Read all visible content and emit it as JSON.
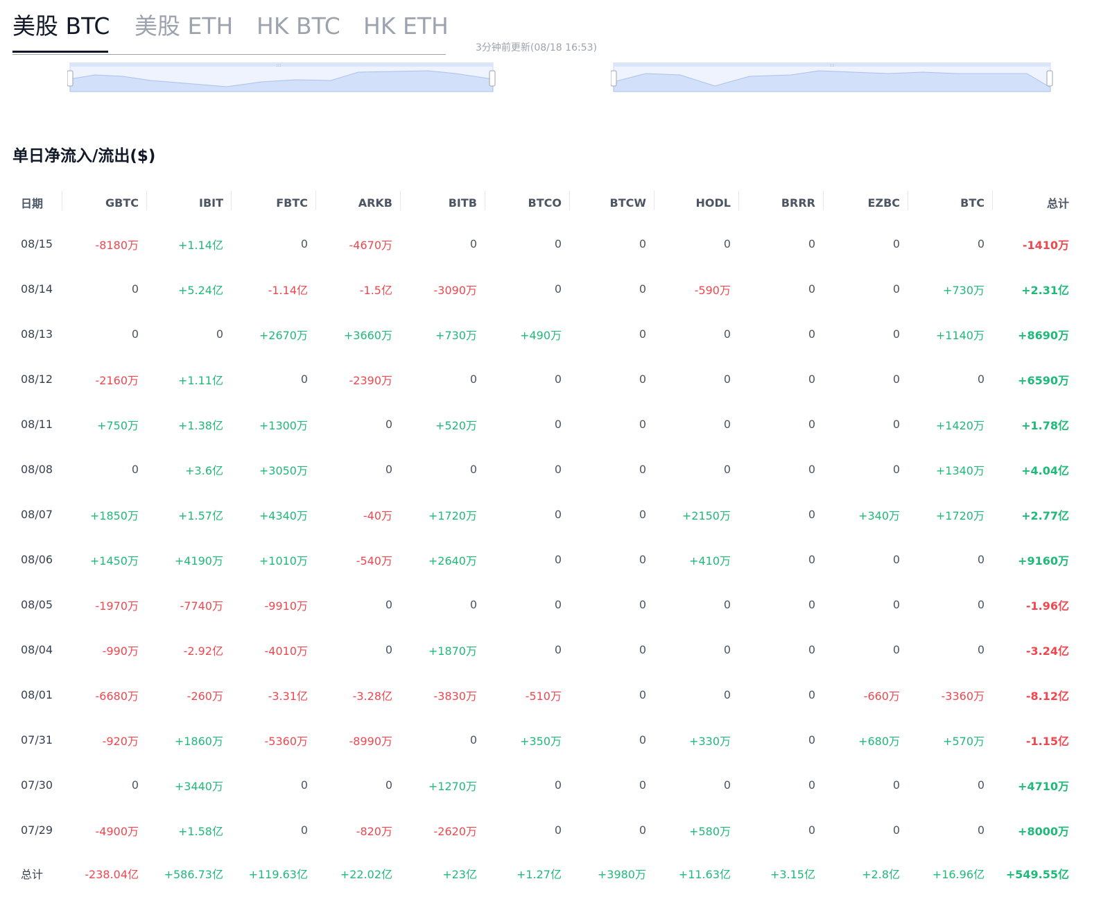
{
  "tabs": [
    {
      "label": "美股 BTC",
      "active": true
    },
    {
      "label": "美股 ETH",
      "active": false
    },
    {
      "label": "HK BTC",
      "active": false
    },
    {
      "label": "HK ETH",
      "active": false
    }
  ],
  "update_note": "3分钟前更新(08/18 16:53)",
  "section_title": "单日净流入/流出($)",
  "colors": {
    "positive": "#1fb978",
    "negative": "#f0474f",
    "slider_fill": "#d6e4fb",
    "slider_line": "#a8c1f0"
  },
  "table": {
    "headers": [
      "日期",
      "GBTC",
      "IBIT",
      "FBTC",
      "ARKB",
      "BITB",
      "BTCO",
      "BTCW",
      "HODL",
      "BRRR",
      "EZBC",
      "BTC",
      "总计"
    ],
    "rows": [
      [
        "08/15",
        "-8180万",
        "+1.14亿",
        "0",
        "-4670万",
        "0",
        "0",
        "0",
        "0",
        "0",
        "0",
        "0",
        "-1410万"
      ],
      [
        "08/14",
        "0",
        "+5.24亿",
        "-1.14亿",
        "-1.5亿",
        "-3090万",
        "0",
        "0",
        "-590万",
        "0",
        "0",
        "+730万",
        "+2.31亿"
      ],
      [
        "08/13",
        "0",
        "0",
        "+2670万",
        "+3660万",
        "+730万",
        "+490万",
        "0",
        "0",
        "0",
        "0",
        "+1140万",
        "+8690万"
      ],
      [
        "08/12",
        "-2160万",
        "+1.11亿",
        "0",
        "-2390万",
        "0",
        "0",
        "0",
        "0",
        "0",
        "0",
        "0",
        "+6590万"
      ],
      [
        "08/11",
        "+750万",
        "+1.38亿",
        "+1300万",
        "0",
        "+520万",
        "0",
        "0",
        "0",
        "0",
        "0",
        "+1420万",
        "+1.78亿"
      ],
      [
        "08/08",
        "0",
        "+3.6亿",
        "+3050万",
        "0",
        "0",
        "0",
        "0",
        "0",
        "0",
        "0",
        "+1340万",
        "+4.04亿"
      ],
      [
        "08/07",
        "+1850万",
        "+1.57亿",
        "+4340万",
        "-40万",
        "+1720万",
        "0",
        "0",
        "+2150万",
        "0",
        "+340万",
        "+1720万",
        "+2.77亿"
      ],
      [
        "08/06",
        "+1450万",
        "+4190万",
        "+1010万",
        "-540万",
        "+2640万",
        "0",
        "0",
        "+410万",
        "0",
        "0",
        "0",
        "+9160万"
      ],
      [
        "08/05",
        "-1970万",
        "-7740万",
        "-9910万",
        "0",
        "0",
        "0",
        "0",
        "0",
        "0",
        "0",
        "0",
        "-1.96亿"
      ],
      [
        "08/04",
        "-990万",
        "-2.92亿",
        "-4010万",
        "0",
        "+1870万",
        "0",
        "0",
        "0",
        "0",
        "0",
        "0",
        "-3.24亿"
      ],
      [
        "08/01",
        "-6680万",
        "-260万",
        "-3.31亿",
        "-3.28亿",
        "-3830万",
        "-510万",
        "0",
        "0",
        "0",
        "-660万",
        "-3360万",
        "-8.12亿"
      ],
      [
        "07/31",
        "-920万",
        "+1860万",
        "-5360万",
        "-8990万",
        "0",
        "+350万",
        "0",
        "+330万",
        "0",
        "+680万",
        "+570万",
        "-1.15亿"
      ],
      [
        "07/30",
        "0",
        "+3440万",
        "0",
        "0",
        "+1270万",
        "0",
        "0",
        "0",
        "0",
        "0",
        "0",
        "+4710万"
      ],
      [
        "07/29",
        "-4900万",
        "+1.58亿",
        "0",
        "-820万",
        "-2620万",
        "0",
        "0",
        "+580万",
        "0",
        "0",
        "0",
        "+8000万"
      ]
    ],
    "total_row": [
      "总计",
      "-238.04亿",
      "+586.73亿",
      "+119.63亿",
      "+22.02亿",
      "+23亿",
      "+1.27亿",
      "+3980万",
      "+11.63亿",
      "+3.15亿",
      "+2.8亿",
      "+16.96亿",
      "+549.55亿"
    ]
  }
}
